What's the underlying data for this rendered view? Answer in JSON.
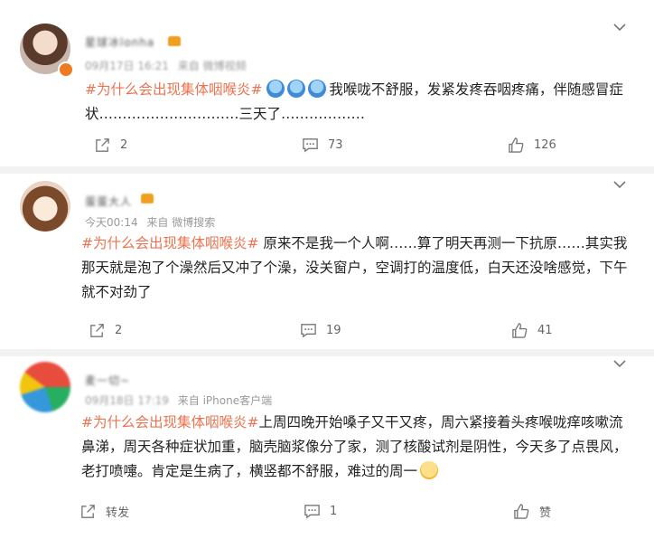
{
  "posts": [
    {
      "username": "星球冰lonha",
      "meta_time": "09月17日 16:21",
      "meta_source": "来自 微博视频",
      "tag": "#为什么会出现集体咽喉炎#",
      "emoji": [
        "blue-crying-face",
        "blue-crying-face",
        "blue-crying-face"
      ],
      "text": "我喉咙不舒服，发紧发疼吞咽疼痛，伴随感冒症状…………………………三天了………………",
      "share": "2",
      "comment": "73",
      "like": "126"
    },
    {
      "username": "蛋蛋大人",
      "meta_time": "今天00:14",
      "meta_source": "来自 微博搜索",
      "tag": "#为什么会出现集体咽喉炎#",
      "text": "原来不是我一个人啊……算了明天再测一下抗原……其实我那天就是泡了个澡然后又冲了个澡，没关窗户，空调打的温度低，白天还没啥感觉，下午就不对劲了",
      "share": "2",
      "comment": "19",
      "like": "41"
    },
    {
      "username": "麦一切~",
      "meta_time": "09月18日 17:19",
      "meta_source": "来自 iPhone客户端",
      "tag": "#为什么会出现集体咽喉炎#",
      "text": "上周四晚开始嗓子又干又疼，周六紧接着头疼喉咙痒咳嗽流鼻涕，周天各种症状加重，脑壳脑浆像分了家，测了核酸试剂是阴性，今天多了点畏风，老打喷嚏。肯定是生病了，横竖都不舒服，难过的周一",
      "end_emoji": "yellow-sad-face",
      "share": "转发",
      "comment": "1",
      "like": "赞"
    }
  ]
}
